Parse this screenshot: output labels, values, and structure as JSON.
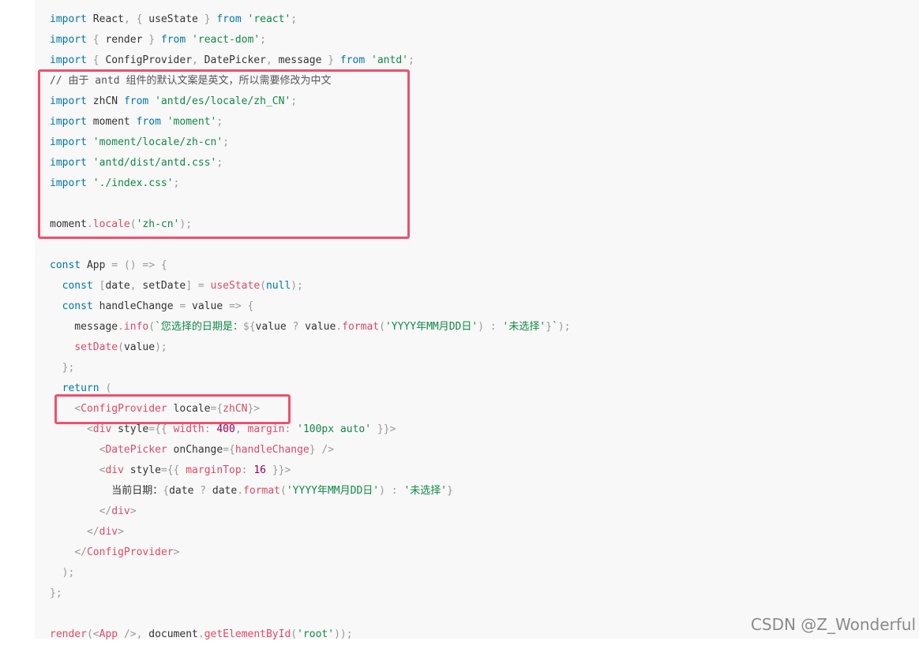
{
  "code_lines": [
    [
      [
        "kw",
        "import"
      ],
      [
        "p",
        " React"
      ],
      [
        "pun",
        ", {"
      ],
      [
        "p",
        " useState "
      ],
      [
        "pun",
        "}"
      ],
      [
        "p",
        " "
      ],
      [
        "kw",
        "from"
      ],
      [
        "p",
        " "
      ],
      [
        "str",
        "'react'"
      ],
      [
        "pun",
        ";"
      ]
    ],
    [
      [
        "kw",
        "import"
      ],
      [
        "p",
        " "
      ],
      [
        "pun",
        "{"
      ],
      [
        "p",
        " render "
      ],
      [
        "pun",
        "}"
      ],
      [
        "p",
        " "
      ],
      [
        "kw",
        "from"
      ],
      [
        "p",
        " "
      ],
      [
        "str",
        "'react-dom'"
      ],
      [
        "pun",
        ";"
      ]
    ],
    [
      [
        "kw",
        "import"
      ],
      [
        "p",
        " "
      ],
      [
        "pun",
        "{"
      ],
      [
        "p",
        " ConfigProvider"
      ],
      [
        "pun",
        ","
      ],
      [
        "p",
        " DatePicker"
      ],
      [
        "pun",
        ","
      ],
      [
        "p",
        " message "
      ],
      [
        "pun",
        "}"
      ],
      [
        "p",
        " "
      ],
      [
        "kw",
        "from"
      ],
      [
        "p",
        " "
      ],
      [
        "str",
        "'antd'"
      ],
      [
        "pun",
        ";"
      ]
    ],
    [
      [
        "cmt",
        "// 由于 antd 组件的默认文案是英文，所以需要修改为中文"
      ]
    ],
    [
      [
        "kw",
        "import"
      ],
      [
        "p",
        " zhCN "
      ],
      [
        "kw",
        "from"
      ],
      [
        "p",
        " "
      ],
      [
        "str",
        "'antd/es/locale/zh_CN'"
      ],
      [
        "pun",
        ";"
      ]
    ],
    [
      [
        "kw",
        "import"
      ],
      [
        "p",
        " moment "
      ],
      [
        "kw",
        "from"
      ],
      [
        "p",
        " "
      ],
      [
        "str",
        "'moment'"
      ],
      [
        "pun",
        ";"
      ]
    ],
    [
      [
        "kw",
        "import"
      ],
      [
        "p",
        " "
      ],
      [
        "str",
        "'moment/locale/zh-cn'"
      ],
      [
        "pun",
        ";"
      ]
    ],
    [
      [
        "kw",
        "import"
      ],
      [
        "p",
        " "
      ],
      [
        "str",
        "'antd/dist/antd.css'"
      ],
      [
        "pun",
        ";"
      ]
    ],
    [
      [
        "kw",
        "import"
      ],
      [
        "p",
        " "
      ],
      [
        "str",
        "'./index.css'"
      ],
      [
        "pun",
        ";"
      ]
    ],
    [],
    [
      [
        "p",
        "moment"
      ],
      [
        "pun",
        "."
      ],
      [
        "fn",
        "locale"
      ],
      [
        "pun",
        "("
      ],
      [
        "str",
        "'zh-cn'"
      ],
      [
        "pun",
        ");"
      ]
    ],
    [],
    [
      [
        "kw",
        "const"
      ],
      [
        "p",
        " App "
      ],
      [
        "pun",
        "="
      ],
      [
        "p",
        " "
      ],
      [
        "pun",
        "()"
      ],
      [
        "p",
        " "
      ],
      [
        "pun",
        "=>"
      ],
      [
        "p",
        " "
      ],
      [
        "pun",
        "{"
      ]
    ],
    [
      [
        "p",
        "  "
      ],
      [
        "kw",
        "const"
      ],
      [
        "p",
        " "
      ],
      [
        "pun",
        "["
      ],
      [
        "p",
        "date"
      ],
      [
        "pun",
        ","
      ],
      [
        "p",
        " setDate"
      ],
      [
        "pun",
        "]"
      ],
      [
        "p",
        " "
      ],
      [
        "pun",
        "="
      ],
      [
        "p",
        " "
      ],
      [
        "fn",
        "useState"
      ],
      [
        "pun",
        "("
      ],
      [
        "kw",
        "null"
      ],
      [
        "pun",
        ");"
      ]
    ],
    [
      [
        "p",
        "  "
      ],
      [
        "kw",
        "const"
      ],
      [
        "p",
        " handleChange "
      ],
      [
        "pun",
        "="
      ],
      [
        "p",
        " value "
      ],
      [
        "pun",
        "=>"
      ],
      [
        "p",
        " "
      ],
      [
        "pun",
        "{"
      ]
    ],
    [
      [
        "p",
        "    message"
      ],
      [
        "pun",
        "."
      ],
      [
        "fn",
        "info"
      ],
      [
        "pun",
        "("
      ],
      [
        "str",
        "`您选择的日期是："
      ],
      [
        "pun",
        "${"
      ],
      [
        "p",
        "value "
      ],
      [
        "pun",
        "?"
      ],
      [
        "p",
        " value"
      ],
      [
        "pun",
        "."
      ],
      [
        "fn",
        "format"
      ],
      [
        "pun",
        "("
      ],
      [
        "str",
        "'YYYY年MM月DD日'"
      ],
      [
        "pun",
        ")"
      ],
      [
        "p",
        " "
      ],
      [
        "pun",
        ":"
      ],
      [
        "p",
        " "
      ],
      [
        "str",
        "'未选择'"
      ],
      [
        "pun",
        "}"
      ],
      [
        "str",
        "`"
      ],
      [
        "pun",
        ");"
      ]
    ],
    [
      [
        "p",
        "    "
      ],
      [
        "fn",
        "setDate"
      ],
      [
        "pun",
        "("
      ],
      [
        "p",
        "value"
      ],
      [
        "pun",
        ");"
      ]
    ],
    [
      [
        "p",
        "  "
      ],
      [
        "pun",
        "};"
      ]
    ],
    [
      [
        "p",
        "  "
      ],
      [
        "kw",
        "return"
      ],
      [
        "p",
        " "
      ],
      [
        "pun",
        "("
      ]
    ],
    [
      [
        "p",
        "    "
      ],
      [
        "pun",
        "<"
      ],
      [
        "tag",
        "ConfigProvider"
      ],
      [
        "p",
        " locale"
      ],
      [
        "pun",
        "={"
      ],
      [
        "tag",
        "zhCN"
      ],
      [
        "pun",
        "}>"
      ]
    ],
    [
      [
        "p",
        "      "
      ],
      [
        "pun",
        "<"
      ],
      [
        "tag",
        "div"
      ],
      [
        "p",
        " style"
      ],
      [
        "pun",
        "={{"
      ],
      [
        "p",
        " "
      ],
      [
        "tag",
        "width"
      ],
      [
        "pun",
        ":"
      ],
      [
        "p",
        " "
      ],
      [
        "num",
        "400"
      ],
      [
        "pun",
        ","
      ],
      [
        "p",
        " "
      ],
      [
        "tag",
        "margin"
      ],
      [
        "pun",
        ":"
      ],
      [
        "p",
        " "
      ],
      [
        "str",
        "'100px auto'"
      ],
      [
        "p",
        " "
      ],
      [
        "pun",
        "}}>"
      ]
    ],
    [
      [
        "p",
        "        "
      ],
      [
        "pun",
        "<"
      ],
      [
        "tag",
        "DatePicker"
      ],
      [
        "p",
        " onChange"
      ],
      [
        "pun",
        "={"
      ],
      [
        "tag",
        "handleChange"
      ],
      [
        "pun",
        "}"
      ],
      [
        "p",
        " "
      ],
      [
        "pun",
        "/>"
      ]
    ],
    [
      [
        "p",
        "        "
      ],
      [
        "pun",
        "<"
      ],
      [
        "tag",
        "div"
      ],
      [
        "p",
        " style"
      ],
      [
        "pun",
        "={{"
      ],
      [
        "p",
        " "
      ],
      [
        "tag",
        "marginTop"
      ],
      [
        "pun",
        ":"
      ],
      [
        "p",
        " "
      ],
      [
        "num",
        "16"
      ],
      [
        "p",
        " "
      ],
      [
        "pun",
        "}}>"
      ]
    ],
    [
      [
        "p",
        "          当前日期："
      ],
      [
        "pun",
        "{"
      ],
      [
        "p",
        "date "
      ],
      [
        "pun",
        "?"
      ],
      [
        "p",
        " date"
      ],
      [
        "pun",
        "."
      ],
      [
        "fn",
        "format"
      ],
      [
        "pun",
        "("
      ],
      [
        "str",
        "'YYYY年MM月DD日'"
      ],
      [
        "pun",
        ")"
      ],
      [
        "p",
        " "
      ],
      [
        "pun",
        ":"
      ],
      [
        "p",
        " "
      ],
      [
        "str",
        "'未选择'"
      ],
      [
        "pun",
        "}"
      ]
    ],
    [
      [
        "p",
        "        "
      ],
      [
        "pun",
        "</"
      ],
      [
        "tag",
        "div"
      ],
      [
        "pun",
        ">"
      ]
    ],
    [
      [
        "p",
        "      "
      ],
      [
        "pun",
        "</"
      ],
      [
        "tag",
        "div"
      ],
      [
        "pun",
        ">"
      ]
    ],
    [
      [
        "p",
        "    "
      ],
      [
        "pun",
        "</"
      ],
      [
        "tag",
        "ConfigProvider"
      ],
      [
        "pun",
        ">"
      ]
    ],
    [
      [
        "p",
        "  "
      ],
      [
        "pun",
        ");"
      ]
    ],
    [
      [
        "pun",
        "};"
      ]
    ],
    [],
    [
      [
        "fn",
        "render"
      ],
      [
        "pun",
        "(<"
      ],
      [
        "tag",
        "App"
      ],
      [
        "p",
        " "
      ],
      [
        "pun",
        "/>,"
      ],
      [
        "p",
        " document"
      ],
      [
        "pun",
        "."
      ],
      [
        "fn",
        "getElementById"
      ],
      [
        "pun",
        "("
      ],
      [
        "str",
        "'root'"
      ],
      [
        "pun",
        "));"
      ]
    ]
  ],
  "highlights": [
    {
      "name": "highlight-locale-imports",
      "color": "#f0506e"
    },
    {
      "name": "highlight-config-provider",
      "color": "#f0506e"
    }
  ],
  "watermark": {
    "text": "CSDN @Z_Wonderful"
  }
}
